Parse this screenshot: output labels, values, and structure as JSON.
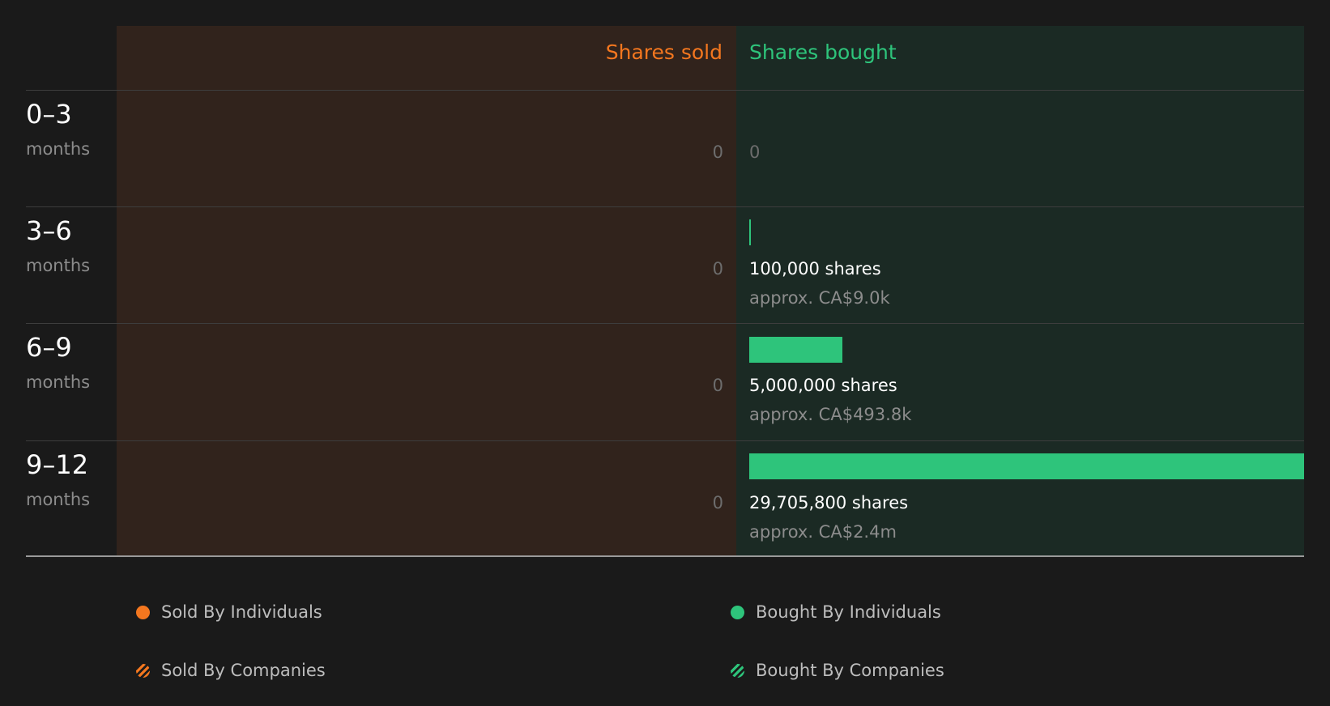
{
  "chart_data": {
    "type": "bar",
    "orientation": "horizontal-diverging",
    "headers": {
      "sold": "Shares sold",
      "bought": "Shares bought"
    },
    "categories": [
      {
        "range": "0–3",
        "unit": "months"
      },
      {
        "range": "3–6",
        "unit": "months"
      },
      {
        "range": "6–9",
        "unit": "months"
      },
      {
        "range": "9–12",
        "unit": "months"
      }
    ],
    "sold": [
      0,
      0,
      0,
      0
    ],
    "bought": [
      0,
      100000,
      5000000,
      29705800
    ],
    "sold_labels": [
      "0",
      "0",
      "0",
      "0"
    ],
    "bought_labels": [
      {
        "shares": "0",
        "approx": ""
      },
      {
        "shares": "100,000 shares",
        "approx": "approx. CA$9.0k"
      },
      {
        "shares": "5,000,000 shares",
        "approx": "approx. CA$493.8k"
      },
      {
        "shares": "29,705,800 shares",
        "approx": "approx. CA$2.4m"
      }
    ],
    "legend": {
      "sold_individuals": "Sold By Individuals",
      "sold_companies": "Sold By Companies",
      "bought_individuals": "Bought By Individuals",
      "bought_companies": "Bought By Companies"
    },
    "colors": {
      "sold": "#f4771f",
      "bought": "#2ec47b",
      "sold_bg": "#31231c",
      "bought_bg": "#1b2a24"
    }
  }
}
